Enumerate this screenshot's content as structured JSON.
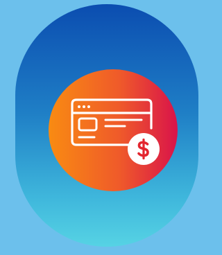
{
  "icon": {
    "name": "credit-card-payment-icon",
    "badge_icon": "dollar-icon",
    "colors": {
      "background": "#6cc0ec",
      "pill_top": "#0b4db0",
      "pill_bottom": "#56d3e4",
      "disc_left": "#f98b12",
      "disc_right": "#d9134a",
      "stroke": "#ffffff"
    }
  }
}
